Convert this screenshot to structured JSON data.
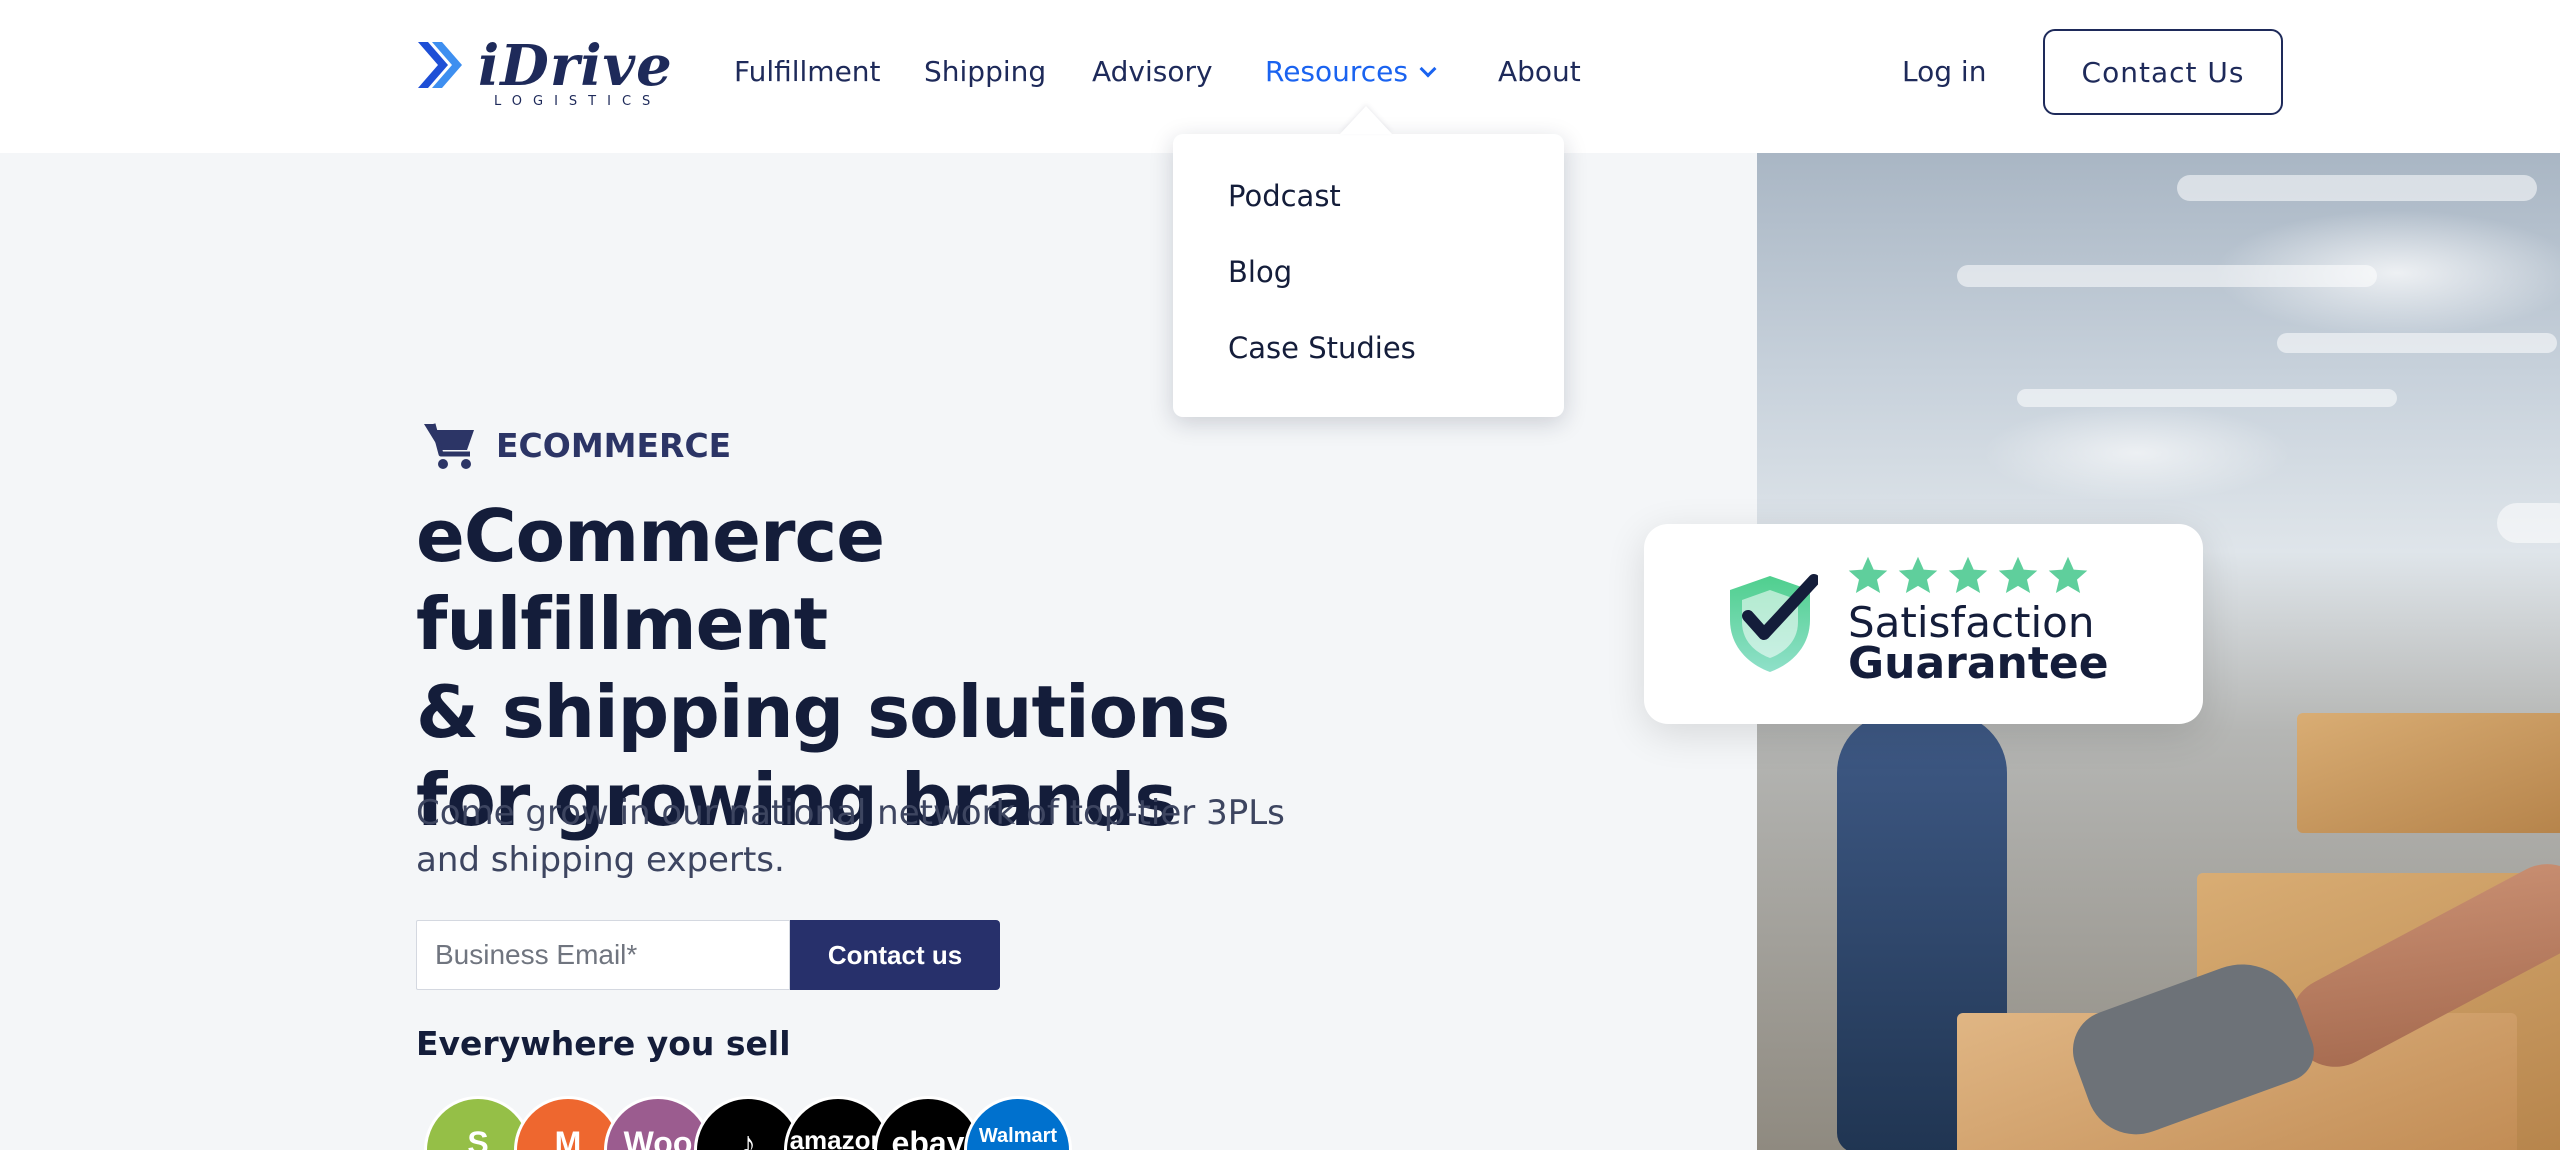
{
  "brand": {
    "name": "iDrive",
    "subtitle": "LOGISTICS"
  },
  "nav": {
    "items": [
      {
        "label": "Fulfillment"
      },
      {
        "label": "Shipping"
      },
      {
        "label": "Advisory"
      },
      {
        "label": "Resources",
        "active": true
      },
      {
        "label": "About"
      }
    ],
    "login_label": "Log in",
    "contact_label": "Contact Us"
  },
  "resources_menu": {
    "items": [
      {
        "label": "Podcast"
      },
      {
        "label": "Blog"
      },
      {
        "label": "Case Studies"
      }
    ]
  },
  "hero": {
    "tag": "ECOMMERCE",
    "tag_icon": "shopping-cart-icon",
    "headline_lines": [
      "eCommerce fulfillment",
      "& shipping solutions",
      "for growing brands"
    ],
    "subtext_lines": [
      "Come grow in our national network of top-tier 3PLs",
      "and shipping experts."
    ],
    "email_placeholder": "Business Email*",
    "submit_label": "Contact us",
    "sell_title": "Everywhere you sell"
  },
  "platforms": [
    {
      "name": "shopify",
      "glyph": "S",
      "color": "#95bf47"
    },
    {
      "name": "magento",
      "glyph": "M",
      "color": "#ee672f"
    },
    {
      "name": "woocommerce",
      "glyph": "Woo",
      "color": "#9b5c8f"
    },
    {
      "name": "tiktok",
      "glyph": "♪",
      "color": "#000000"
    },
    {
      "name": "amazon",
      "glyph": "amazon",
      "color": "#000000"
    },
    {
      "name": "ebay",
      "glyph": "ebay",
      "color": "#000000"
    },
    {
      "name": "walmart",
      "glyph": "Walmart",
      "color": "#0071ce"
    }
  ],
  "badge": {
    "line1": "Satisfaction",
    "line2": "Guarantee",
    "stars": 5,
    "accent_color": "#5fcf9c"
  },
  "colors": {
    "brand_navy": "#1e2a5a",
    "active_link": "#1a63f0",
    "button_navy": "#27306b",
    "page_bg": "#f4f6f8"
  }
}
